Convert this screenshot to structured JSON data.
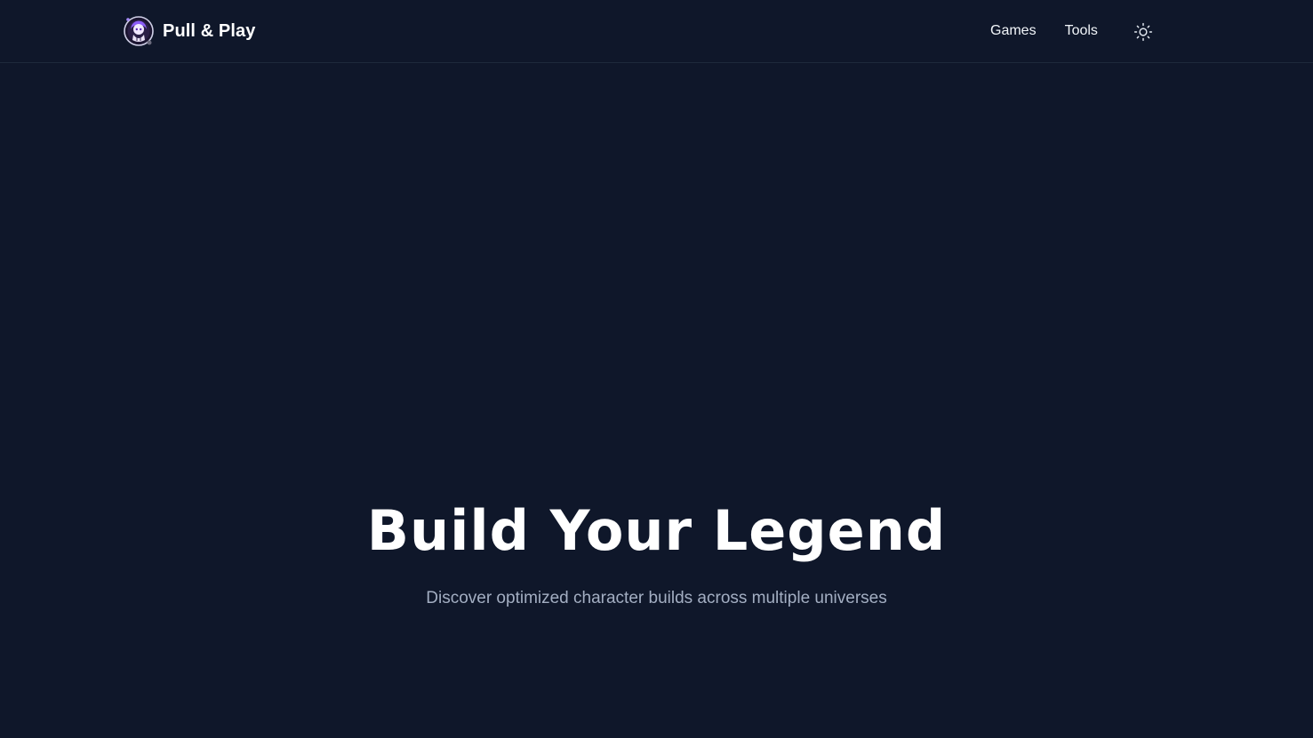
{
  "header": {
    "brand_name": "Pull & Play",
    "logo_icon": "chibi-character-logo-icon",
    "nav": [
      {
        "label": "Games"
      },
      {
        "label": "Tools"
      }
    ],
    "theme_toggle_icon": "sun-icon"
  },
  "hero": {
    "title": "Build Your Legend",
    "subtitle": "Discover optimized character builds across multiple universes"
  },
  "colors": {
    "background": "#0f172a",
    "header_border": "#1e293b",
    "text_primary": "#ffffff",
    "text_muted": "#a3aec2",
    "logo_accent": "#8b5cf6"
  }
}
